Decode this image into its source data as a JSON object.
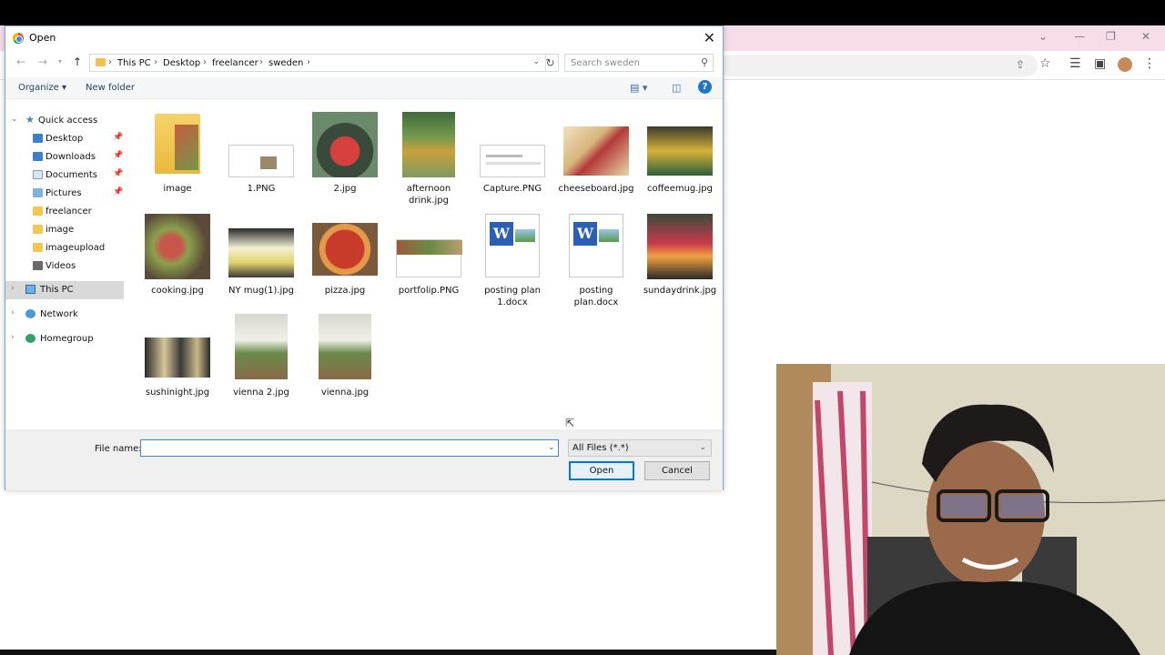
{
  "browser": {
    "controls": {
      "minimize": "—",
      "restore": "❐",
      "close": "✕",
      "dropdown": "⌄"
    }
  },
  "dialog": {
    "title": "Open",
    "close_symbol": "✕",
    "breadcrumb": [
      "This PC",
      "Desktop",
      "freelancer",
      "sweden"
    ],
    "search_placeholder": "Search sweden",
    "toolbar": {
      "organize": "Organize ▾",
      "new_folder": "New folder",
      "help": "?"
    },
    "sidebar": [
      {
        "label": "Quick access",
        "icon": "star-icon"
      },
      {
        "label": "Desktop",
        "icon": "desktop-folder-icon",
        "pinned": true
      },
      {
        "label": "Downloads",
        "icon": "downloads-folder-icon",
        "pinned": true
      },
      {
        "label": "Documents",
        "icon": "documents-folder-icon",
        "pinned": true
      },
      {
        "label": "Pictures",
        "icon": "pictures-folder-icon",
        "pinned": true
      },
      {
        "label": "freelancer",
        "icon": "folder-icon"
      },
      {
        "label": "image",
        "icon": "folder-icon"
      },
      {
        "label": "imageupload",
        "icon": "folder-icon"
      },
      {
        "label": "Videos",
        "icon": "videos-folder-icon"
      },
      {
        "label": "This PC",
        "icon": "pc-icon",
        "selected": true
      },
      {
        "label": "Network",
        "icon": "network-icon"
      },
      {
        "label": "Homegroup",
        "icon": "homegroup-icon"
      }
    ],
    "files": [
      {
        "name": "image",
        "kind": "folder"
      },
      {
        "name": "1.PNG",
        "kind": "screenshot"
      },
      {
        "name": "2.jpg",
        "kind": "photo"
      },
      {
        "name": "afternoon drink.jpg",
        "kind": "photo"
      },
      {
        "name": "Capture.PNG",
        "kind": "screenshot"
      },
      {
        "name": "cheeseboard.jpg",
        "kind": "photo"
      },
      {
        "name": "coffeemug.jpg",
        "kind": "photo"
      },
      {
        "name": "cooking.jpg",
        "kind": "photo"
      },
      {
        "name": "NY mug(1).jpg",
        "kind": "photo"
      },
      {
        "name": "pizza.jpg",
        "kind": "photo"
      },
      {
        "name": "portfolip.PNG",
        "kind": "screenshot"
      },
      {
        "name": "posting plan 1.docx",
        "kind": "word"
      },
      {
        "name": "posting plan.docx",
        "kind": "word"
      },
      {
        "name": "sundaydrink.jpg",
        "kind": "photo"
      },
      {
        "name": "sushinight.jpg",
        "kind": "photo"
      },
      {
        "name": "vienna 2.jpg",
        "kind": "photo"
      },
      {
        "name": "vienna.jpg",
        "kind": "photo"
      }
    ],
    "footer": {
      "file_name_label": "File name:",
      "file_name_value": "",
      "file_type": "All Files (*.*)",
      "open": "Open",
      "cancel": "Cancel"
    }
  }
}
